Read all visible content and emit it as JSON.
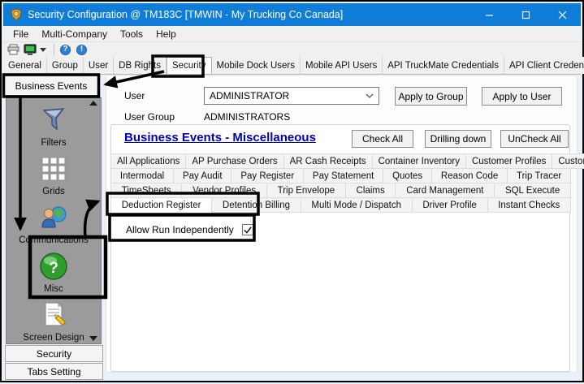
{
  "window": {
    "title": "Security Configuration @ TM183C [TMWIN - My Trucking Co Canada]"
  },
  "menu": {
    "items": [
      "File",
      "Multi-Company",
      "Tools",
      "Help"
    ]
  },
  "main_tabs": {
    "selected": "Security",
    "items": [
      "General",
      "Group",
      "User",
      "DB Rights",
      "Security",
      "Mobile Dock Users",
      "Mobile API Users",
      "API TruckMate Credentials",
      "API Client Credentials"
    ]
  },
  "sidebar": {
    "top_button": "Business Events",
    "items": [
      {
        "icon": "filters-icon",
        "label": "Filters"
      },
      {
        "icon": "grids-icon",
        "label": "Grids"
      },
      {
        "icon": "communications-icon",
        "label": "Communications"
      },
      {
        "icon": "misc-icon",
        "label": "Misc"
      },
      {
        "icon": "screen-design-icon",
        "label": "Screen Design"
      }
    ],
    "bottom_buttons": [
      "Security",
      "Tabs Setting"
    ]
  },
  "form": {
    "user_label": "User",
    "user_value": "ADMINISTRATOR",
    "user_group_label": "User Group",
    "user_group_value": "ADMINISTRATORS",
    "apply_to_group": "Apply to Group",
    "apply_to_user": "Apply to User"
  },
  "panel": {
    "heading": "Business Events - Miscellaneous",
    "check_all": "Check All",
    "drilling_down": "Drilling down",
    "uncheck_all": "UnCheck All",
    "selected_tab": "Deduction Register",
    "tab_rows": [
      [
        "All Applications",
        "AP Purchase Orders",
        "AR Cash Receipts",
        "Container Inventory",
        "Customer Profiles",
        "Customer Service"
      ],
      [
        "Intermodal",
        "Pay Audit",
        "Pay Register",
        "Pay Statement",
        "Quotes",
        "Reason Code",
        "Trip Tracer"
      ],
      [
        "TimeSheets",
        "Vendor Profiles",
        "Trip Envelope",
        "Claims",
        "Card Management",
        "SQL Execute"
      ],
      [
        "Deduction Register",
        "Detention Billing",
        "Multi Mode / Dispatch",
        "Driver Profile",
        "Instant Checks"
      ]
    ],
    "checkbox_label": "Allow Run Independently",
    "checkbox_checked": true
  },
  "colors": {
    "titlebar": "#0f7cd7",
    "heading": "#0000b4",
    "sidebar_panel": "#9b9b9b",
    "annotation": "#000000"
  }
}
